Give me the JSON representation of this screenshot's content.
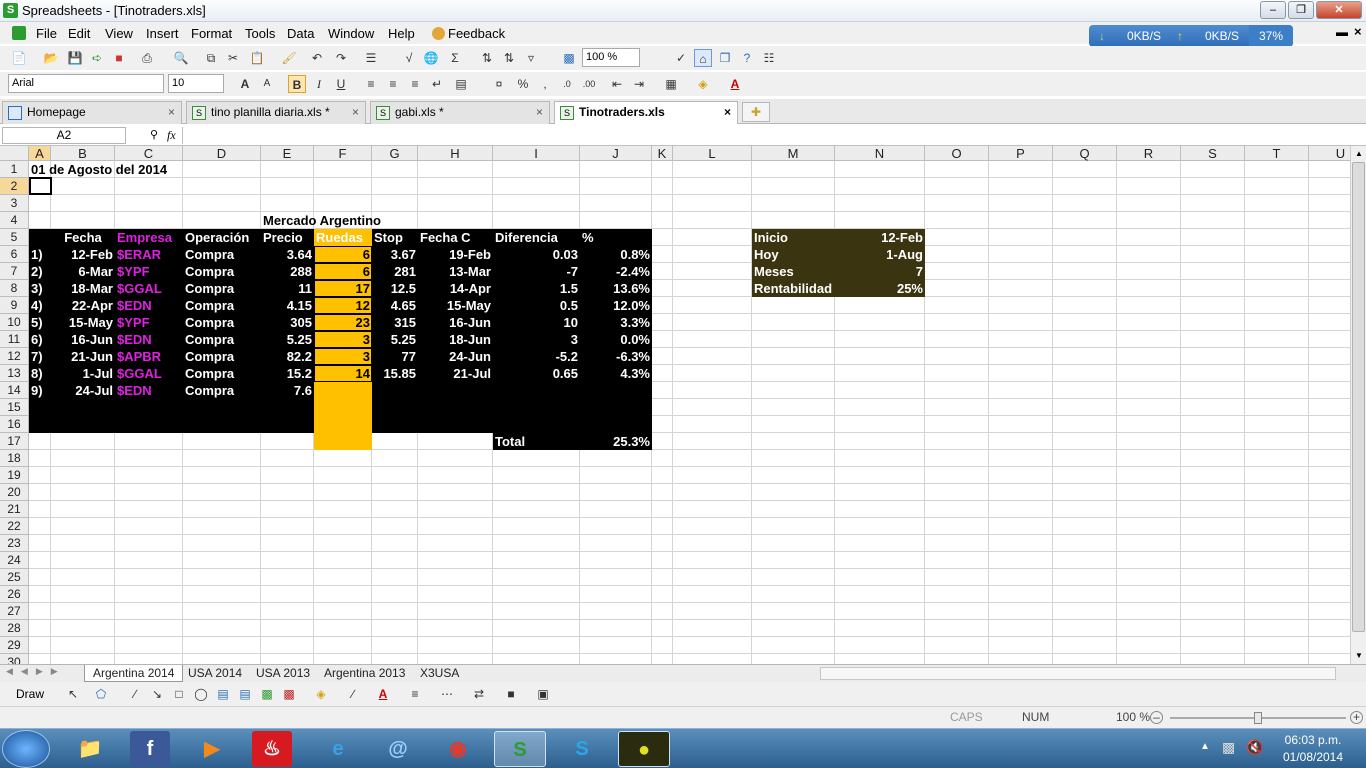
{
  "window": {
    "title": "Spreadsheets - [Tinotraders.xls]"
  },
  "menu": [
    "File",
    "Edit",
    "View",
    "Insert",
    "Format",
    "Tools",
    "Data",
    "Window",
    "Help",
    "Feedback"
  ],
  "net_widget": {
    "down": "0KB/S",
    "up": "0KB/S",
    "percent": "37%"
  },
  "format_bar": {
    "font": "Arial",
    "size": "10",
    "zoom": "100 %"
  },
  "doc_tabs": [
    {
      "label": "Homepage"
    },
    {
      "label": "tino planilla diaria.xls *"
    },
    {
      "label": "gabi.xls *"
    },
    {
      "label": "Tinotraders.xls"
    }
  ],
  "formula": {
    "cell_ref": "A2",
    "fx": "fx"
  },
  "columns": [
    "A",
    "B",
    "C",
    "D",
    "E",
    "F",
    "G",
    "H",
    "I",
    "J",
    "K",
    "L",
    "M",
    "N",
    "O",
    "P",
    "Q",
    "R",
    "S",
    "T",
    "U"
  ],
  "rows": [
    "1",
    "2",
    "3",
    "4",
    "5",
    "6",
    "7",
    "8",
    "9",
    "10",
    "11",
    "12",
    "13",
    "14",
    "15",
    "16",
    "17",
    "18",
    "19",
    "20",
    "21",
    "22",
    "23",
    "24",
    "25",
    "26",
    "27",
    "28",
    "29",
    "30"
  ],
  "sheet": {
    "date_title": "01 de Agosto del 2014",
    "section_title": "Mercado Argentino",
    "headers": [
      "Fecha",
      "Empresa",
      "Operación",
      "Precio",
      "Ruedas",
      "Stop",
      "Fecha C",
      "Diferencia",
      "%"
    ],
    "trades": [
      {
        "n": "1)",
        "fecha": "12-Feb",
        "empresa": "$ERAR",
        "op": "Compra",
        "precio": "3.64",
        "ruedas": "6",
        "stop": "3.67",
        "fechac": "19-Feb",
        "dif": "0.03",
        "pct": "0.8%"
      },
      {
        "n": "2)",
        "fecha": "6-Mar",
        "empresa": "$YPF",
        "op": "Compra",
        "precio": "288",
        "ruedas": "6",
        "stop": "281",
        "fechac": "13-Mar",
        "dif": "-7",
        "pct": "-2.4%"
      },
      {
        "n": "3)",
        "fecha": "18-Mar",
        "empresa": "$GGAL",
        "op": "Compra",
        "precio": "11",
        "ruedas": "17",
        "stop": "12.5",
        "fechac": "14-Apr",
        "dif": "1.5",
        "pct": "13.6%"
      },
      {
        "n": "4)",
        "fecha": "22-Apr",
        "empresa": "$EDN",
        "op": "Compra",
        "precio": "4.15",
        "ruedas": "12",
        "stop": "4.65",
        "fechac": "15-May",
        "dif": "0.5",
        "pct": "12.0%"
      },
      {
        "n": "5)",
        "fecha": "15-May",
        "empresa": "$YPF",
        "op": "Compra",
        "precio": "305",
        "ruedas": "23",
        "stop": "315",
        "fechac": "16-Jun",
        "dif": "10",
        "pct": "3.3%"
      },
      {
        "n": "6)",
        "fecha": "16-Jun",
        "empresa": "$EDN",
        "op": "Compra",
        "precio": "5.25",
        "ruedas": "3",
        "stop": "5.25",
        "fechac": "18-Jun",
        "dif": "3",
        "pct": "0.0%"
      },
      {
        "n": "7)",
        "fecha": "21-Jun",
        "empresa": "$APBR",
        "op": "Compra",
        "precio": "82.2",
        "ruedas": "3",
        "stop": "77",
        "fechac": "24-Jun",
        "dif": "-5.2",
        "pct": "-6.3%"
      },
      {
        "n": "8)",
        "fecha": "1-Jul",
        "empresa": "$GGAL",
        "op": "Compra",
        "precio": "15.2",
        "ruedas": "14",
        "stop": "15.85",
        "fechac": "21-Jul",
        "dif": "0.65",
        "pct": "4.3%"
      },
      {
        "n": "9)",
        "fecha": "24-Jul",
        "empresa": "$EDN",
        "op": "Compra",
        "precio": "7.6",
        "ruedas": "",
        "stop": "",
        "fechac": "",
        "dif": "",
        "pct": ""
      }
    ],
    "total_label": "Total",
    "total_value": "25.3%",
    "summary": [
      {
        "label": "Inicio",
        "value": "12-Feb"
      },
      {
        "label": "Hoy",
        "value": "1-Aug"
      },
      {
        "label": "Meses",
        "value": "7"
      },
      {
        "label": "Rentabilidad",
        "value": "25%"
      }
    ]
  },
  "sheet_tabs": [
    "Argentina 2014",
    "USA 2014",
    "USA 2013",
    "Argentina 2013",
    "X3USA"
  ],
  "draw_label": "Draw",
  "status": {
    "caps": "CAPS",
    "num": "NUM",
    "zoom": "100 %"
  },
  "clock": {
    "time": "06:03 p.m.",
    "date": "01/08/2014"
  },
  "colors": {
    "black_block": "#000000",
    "ruedas": "#ffc000",
    "empresa": "#e020e0",
    "summary_bg": "#3a3410"
  }
}
